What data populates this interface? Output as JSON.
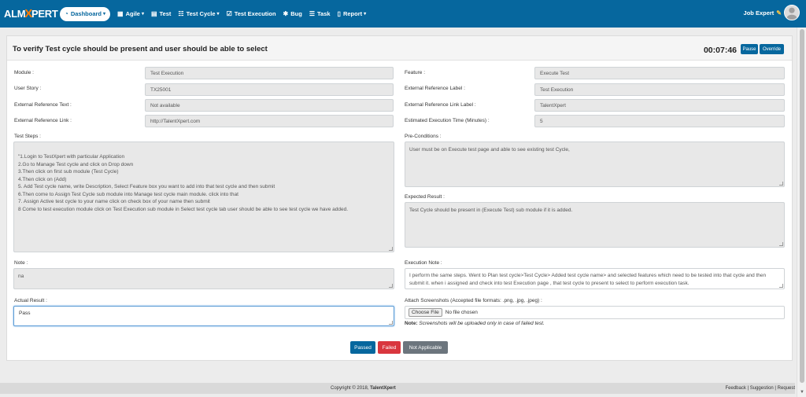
{
  "logo": {
    "left": "ALM",
    "x": "X",
    "right": "PERT"
  },
  "nav": {
    "items": [
      {
        "label": "Dashboard",
        "icon": "speedometer-icon",
        "glyph": "◔",
        "caret": true,
        "active": true
      },
      {
        "label": "Agile",
        "icon": "agile-icon",
        "glyph": "▦",
        "caret": true
      },
      {
        "label": "Test",
        "icon": "test-icon",
        "glyph": "▤"
      },
      {
        "label": "Test Cycle",
        "icon": "test-cycle-icon",
        "glyph": "☷",
        "caret": true
      },
      {
        "label": "Test Execution",
        "icon": "check-square-icon",
        "glyph": "☑"
      },
      {
        "label": "Bug",
        "icon": "bug-icon",
        "glyph": "✱"
      },
      {
        "label": "Task",
        "icon": "task-icon",
        "glyph": "☰"
      },
      {
        "label": "Report",
        "icon": "report-icon",
        "glyph": "▯",
        "caret": true
      }
    ],
    "user": "Job Expert"
  },
  "page": {
    "title": "To verify Test cycle should be present and user should be able to select",
    "timer": "00:07:46",
    "pause_label": "Pause",
    "override_label": "Override"
  },
  "form": {
    "module_label": "Module :",
    "module_value": "Test Execution",
    "user_story_label": "User Story :",
    "user_story_value": "TX25001",
    "ext_ref_text_label": "External Reference Text :",
    "ext_ref_text_value": "Not available",
    "ext_ref_link_label": "External Reference Link :",
    "ext_ref_link_value": "http://TalentXpert.com",
    "feature_label": "Feature :",
    "feature_value": "Execute Test",
    "ext_ref_label_label": "External Reference Label :",
    "ext_ref_label_value": "Test Execution",
    "ext_ref_link_label_label": "External Reference Link Label :",
    "ext_ref_link_label_value": "TalentXpert",
    "est_time_label": "Estimated Execution Time (Minutes) :",
    "est_time_value": "5",
    "test_steps_label": "Test Steps :",
    "test_steps": [
      "\"1.Login to TestXpert with particular Application",
      "2.Go to Manage Test cycle and click on Drop down",
      "3.Then click on first sub module (Test Cycle)",
      "4.Then click on (Add)",
      "5. Add Test cycle name, write Description, Select Feature box you want to add into that test cycle and then submit",
      "6.Then come to Assign Test Cycle sub module into Manage test cycle main module. click into that",
      "7. Assign Active test cycle to your name click on check box of your name then submit",
      "8 Come to test execution  module click on Test Execution sub module in Select test cycle tab user should be able to see test cycle we have added."
    ],
    "preconditions_label": "Pre-Conditions :",
    "preconditions_value": "User must be on Execute test page and able to see existing test Cycle,",
    "expected_label": "Expected Result :",
    "expected_value": "Test Cycle should be present in (Execute Test) sub module if it is added.",
    "note_label": "Note :",
    "note_value": "na",
    "exec_note_label": "Execution Note :",
    "exec_note_value": "I perform the same steps. Went to Plan test cycle>Test Cycle> Added test cycle name> and selected features which need to be tested into that cycle and then submit it. when i assigned and check into test Execution page , that test cycle to present to select to perform execution task.",
    "actual_label": "Actual Result :",
    "actual_value": "Pass",
    "attach_label": "Attach Screenshots (Accepted file formats: .png, .jpg, .jpeg) :",
    "choose_file_label": "Choose File",
    "no_file_text": "No file chosen",
    "attach_note_bold": "Note:",
    "attach_note_text": "Screenshots will be uploaded only in case of failed test."
  },
  "actions": {
    "passed": "Passed",
    "failed": "Failed",
    "not_applicable": "Not Applicable"
  },
  "colors": {
    "navbar": "#06679e",
    "passed": "#06679e",
    "failed": "#d9363e",
    "not_applicable": "#6c757d"
  },
  "footer": {
    "copyright_prefix": "Copyright © 2018,",
    "copyright_brand": "TalentXpert",
    "links": "Feedback | Suggestion | Request"
  }
}
